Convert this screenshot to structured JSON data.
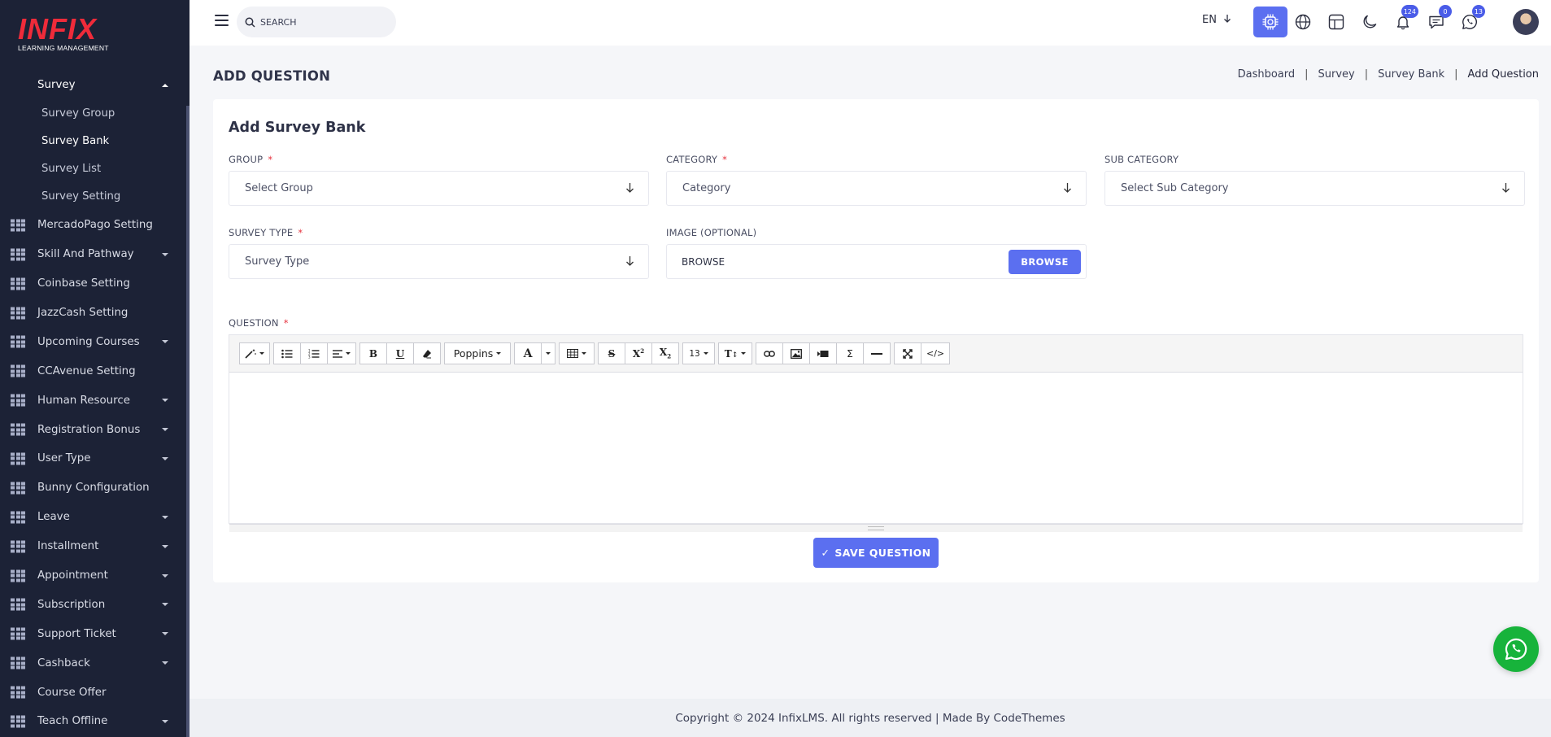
{
  "brand": {
    "logo_word": "INFIX",
    "logo_sub": "LEARNING MANAGEMENT"
  },
  "sidebar": {
    "survey": {
      "label": "Survey",
      "icon": "document-icon"
    },
    "survey_children": [
      {
        "label": "Survey Group"
      },
      {
        "label": "Survey Bank",
        "active": true
      },
      {
        "label": "Survey List"
      },
      {
        "label": "Survey Setting"
      }
    ],
    "items": [
      {
        "label": "MercadoPago Setting",
        "has_children": false
      },
      {
        "label": "Skill And Pathway",
        "has_children": true
      },
      {
        "label": "Coinbase Setting",
        "has_children": false
      },
      {
        "label": "JazzCash Setting",
        "has_children": false
      },
      {
        "label": "Upcoming Courses",
        "has_children": true
      },
      {
        "label": "CCAvenue Setting",
        "has_children": false
      },
      {
        "label": "Human Resource",
        "has_children": true
      },
      {
        "label": "Registration Bonus",
        "has_children": true
      },
      {
        "label": "User Type",
        "has_children": true
      },
      {
        "label": "Bunny Configuration",
        "has_children": false
      },
      {
        "label": "Leave",
        "has_children": true
      },
      {
        "label": "Installment",
        "has_children": true
      },
      {
        "label": "Appointment",
        "has_children": true
      },
      {
        "label": "Subscription",
        "has_children": true
      },
      {
        "label": "Support Ticket",
        "has_children": true
      },
      {
        "label": "Cashback",
        "has_children": true
      },
      {
        "label": "Course Offer",
        "has_children": false
      },
      {
        "label": "Teach Offline",
        "has_children": true
      }
    ]
  },
  "topbar": {
    "search_placeholder": "SEARCH",
    "language": "EN",
    "notifications_count": "124",
    "messages_count": "0",
    "whatsapp_count": "13"
  },
  "page": {
    "title": "ADD QUESTION",
    "breadcrumb": [
      "Dashboard",
      "Survey",
      "Survey Bank",
      "Add Question"
    ]
  },
  "form": {
    "card_title": "Add Survey Bank",
    "group": {
      "label": "GROUP",
      "value": "Select Group",
      "required": true
    },
    "category": {
      "label": "CATEGORY",
      "value": "Category",
      "required": true
    },
    "sub_category": {
      "label": "SUB CATEGORY",
      "value": "Select Sub Category"
    },
    "survey_type": {
      "label": "SURVEY TYPE",
      "value": "Survey Type",
      "required": true
    },
    "image": {
      "label": "IMAGE (OPTIONAL)",
      "value": "BROWSE",
      "button": "BROWSE"
    },
    "question": {
      "label": "QUESTION",
      "required": true
    },
    "required_mark": "*",
    "editor": {
      "font_name": "Poppins",
      "font_size": "13"
    },
    "save_label": "SAVE QUESTION",
    "save_check": "✓"
  },
  "footer": {
    "text": "Copyright © 2024 InfixLMS. All rights reserved | Made By CodeThemes"
  },
  "colors": {
    "sidebar_bg": "#1c2236",
    "accent": "#5b6ff0",
    "logo_red": "#ef2b3a",
    "whatsapp": "#17b33b"
  }
}
